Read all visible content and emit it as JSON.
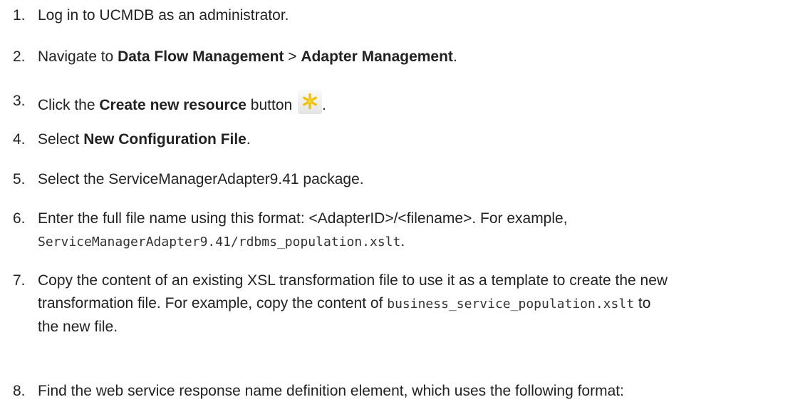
{
  "steps": [
    {
      "number": "1.",
      "text": "Log in to UCMDB as an administrator."
    },
    {
      "number": "2.",
      "before": "Navigate to ",
      "bold1": "Data Flow Management",
      "middle": " > ",
      "bold2": "Adapter Management",
      "after": "."
    },
    {
      "number": "3.",
      "before": "Click the ",
      "bold": "Create new resource",
      "after_bold": " button",
      "icon": "asterisk-icon",
      "end": "."
    },
    {
      "number": "4.",
      "before": "Select ",
      "bold": "New Configuration File",
      "after": "."
    },
    {
      "number": "5.",
      "text": "Select the ServiceManagerAdapter9.41 package."
    },
    {
      "number": "6.",
      "text": "Enter the full file name using this format: <AdapterID>/<filename>. For example,",
      "code": "ServiceManagerAdapter9.41/rdbms_population.xslt",
      "end": "."
    },
    {
      "number": "7.",
      "line1": "Copy the content of an existing XSL transformation file to use it as a template to create the new",
      "line2_before": "transformation file. For example, copy the content of ",
      "code": "business_service_population.xslt",
      "line2_after": " to",
      "line3": "the new file."
    },
    {
      "number": "8.",
      "text": "Find the web service response name definition element, which uses the following format:"
    }
  ],
  "colors": {
    "text": "#222222",
    "icon_star": "#f2c200"
  }
}
